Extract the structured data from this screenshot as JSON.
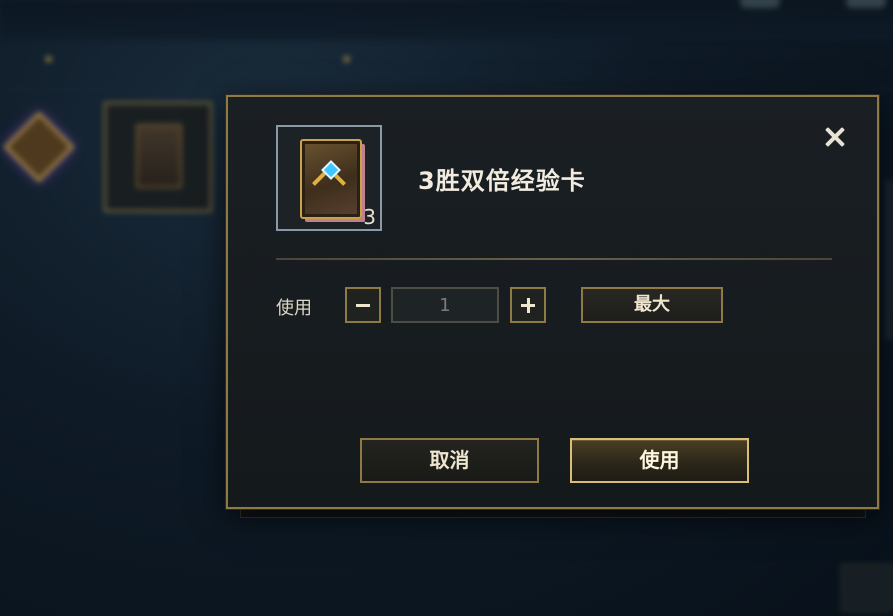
{
  "dialog": {
    "item_name": "3胜双倍经验卡",
    "item_count": "3",
    "item_icon": "exp-card-icon",
    "use_label": "使用",
    "quantity_value": "1",
    "max_label": "最大",
    "cancel_label": "取消",
    "confirm_label": "使用",
    "close_icon": "close-icon"
  },
  "colors": {
    "gold_border": "#8f7a45",
    "gold_highlight": "#d9be78",
    "dialog_bg": "#14191c",
    "text_primary": "#f1ecdf"
  }
}
